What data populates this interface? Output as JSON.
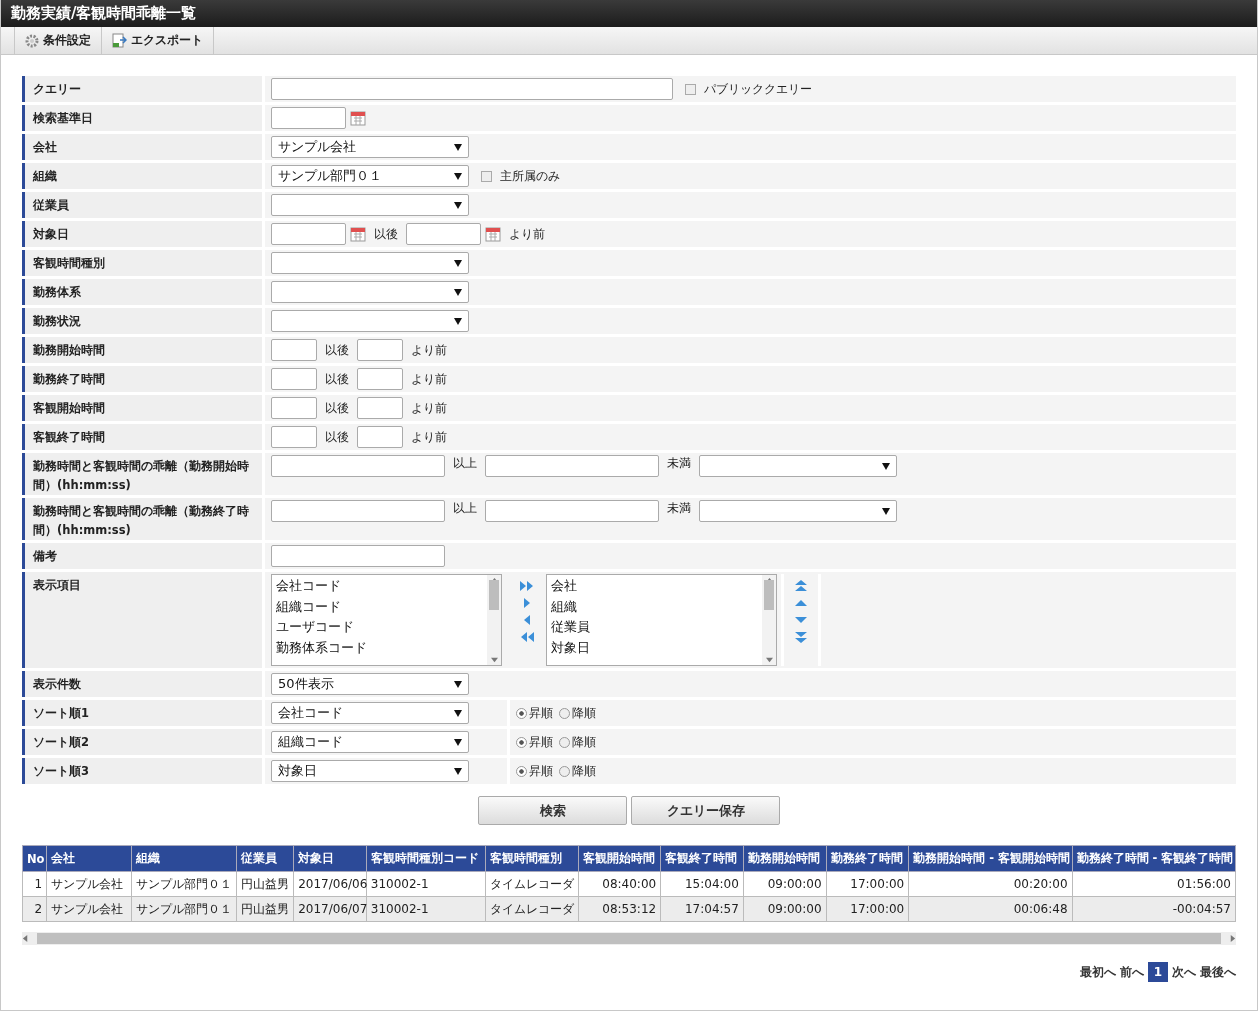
{
  "window": {
    "title": "勤務実績/客観時間乖離一覧"
  },
  "toolbar": [
    {
      "label": "条件設定"
    },
    {
      "label": "エクスポート"
    }
  ],
  "form": [
    {
      "kind": "query",
      "label": "クエリー",
      "checkbox": {
        "label": "パブリッククエリー",
        "checked": false
      }
    },
    {
      "kind": "date",
      "label": "検索基準日"
    },
    {
      "kind": "select",
      "label": "会社",
      "value": "サンプル会社"
    },
    {
      "kind": "select",
      "label": "組織",
      "value": "サンプル部門０１",
      "checkbox": {
        "label": "主所属のみ",
        "checked": false
      }
    },
    {
      "kind": "select",
      "label": "従業員"
    },
    {
      "kind": "daterange",
      "label": "対象日",
      "from_suffix": "以後",
      "to_suffix": "より前"
    },
    {
      "kind": "select",
      "label": "客観時間種別"
    },
    {
      "kind": "select",
      "label": "勤務体系"
    },
    {
      "kind": "select",
      "label": "勤務状況"
    },
    {
      "kind": "timerange",
      "label": "勤務開始時間",
      "from_suffix": "以後",
      "to_suffix": "より前"
    },
    {
      "kind": "timerange",
      "label": "勤務終了時間",
      "from_suffix": "以後",
      "to_suffix": "より前"
    },
    {
      "kind": "timerange",
      "label": "客観開始時間",
      "from_suffix": "以後",
      "to_suffix": "より前"
    },
    {
      "kind": "timerange",
      "label": "客観終了時間",
      "from_suffix": "以後",
      "to_suffix": "より前"
    },
    {
      "kind": "diffrange",
      "label": "勤務時間と客観時間の乖離（勤務開始時間）(hh:mm:ss)",
      "from_suffix": "以上",
      "to_suffix": "未満"
    },
    {
      "kind": "diffrange",
      "label": "勤務時間と客観時間の乖離（勤務終了時間）(hh:mm:ss)",
      "from_suffix": "以上",
      "to_suffix": "未満"
    },
    {
      "kind": "memo",
      "label": "備考"
    },
    {
      "kind": "listbox",
      "label": "表示項目",
      "available": [
        "会社コード",
        "組織コード",
        "ユーザコード",
        "勤務体系コード"
      ],
      "chosen": [
        "会社",
        "組織",
        "従業員",
        "対象日"
      ]
    },
    {
      "kind": "select",
      "label": "表示件数",
      "value": "50件表示"
    },
    {
      "kind": "sort",
      "label": "ソート順1",
      "value": "会社コード",
      "options": [
        {
          "label": "昇順",
          "selected": true
        },
        {
          "label": "降順",
          "selected": false
        }
      ]
    },
    {
      "kind": "sort",
      "label": "ソート順2",
      "value": "組織コード",
      "options": [
        {
          "label": "昇順",
          "selected": true
        },
        {
          "label": "降順",
          "selected": false
        }
      ]
    },
    {
      "kind": "sort",
      "label": "ソート順3",
      "value": "対象日",
      "options": [
        {
          "label": "昇順",
          "selected": true
        },
        {
          "label": "降順",
          "selected": false
        }
      ]
    }
  ],
  "buttons": [
    "検索",
    "クエリー保存"
  ],
  "table": {
    "columns": [
      "No",
      "会社",
      "組織",
      "従業員",
      "対象日",
      "客観時間種別コード",
      "客観時間種別",
      "客観開始時間",
      "客観終了時間",
      "勤務開始時間",
      "勤務終了時間",
      "勤務開始時間 - 客観開始時間",
      "勤務終了時間 - 客観終了時間"
    ],
    "rows": [
      [
        "1",
        "サンプル会社",
        "サンプル部門０１",
        "円山益男",
        "2017/06/06",
        "310002-1",
        "タイムレコーダ",
        "08:40:00",
        "15:04:00",
        "09:00:00",
        "17:00:00",
        "00:20:00",
        "01:56:00"
      ],
      [
        "2",
        "サンプル会社",
        "サンプル部門０１",
        "円山益男",
        "2017/06/07",
        "310002-1",
        "タイムレコーダ",
        "08:53:12",
        "17:04:57",
        "09:00:00",
        "17:00:00",
        "00:06:48",
        "-00:04:57"
      ]
    ]
  },
  "pagination": [
    {
      "label": "最初へ",
      "kind": "link",
      "selected": false
    },
    {
      "label": "前へ",
      "kind": "link",
      "selected": false
    },
    {
      "label": "1",
      "kind": "page",
      "selected": true
    },
    {
      "label": "次へ",
      "kind": "link",
      "selected": false
    },
    {
      "label": "最後へ",
      "kind": "link",
      "selected": false
    }
  ]
}
